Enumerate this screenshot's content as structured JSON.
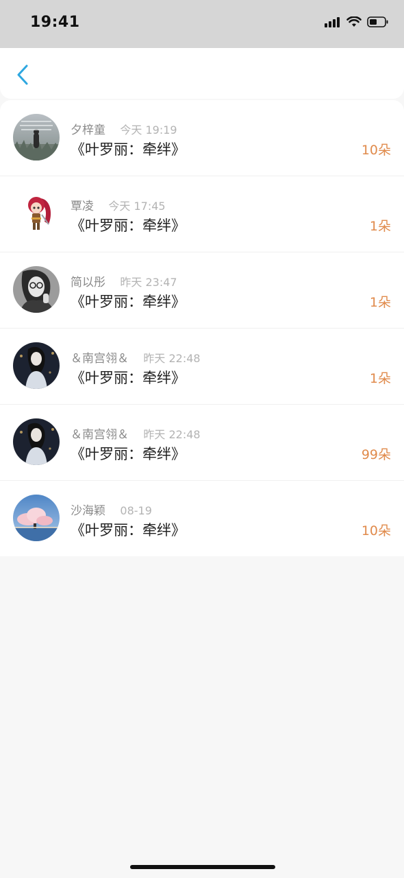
{
  "status_bar": {
    "time": "19:41"
  },
  "nav": {
    "back_icon": "chevron-left-icon",
    "accent_color": "#2ea7e0"
  },
  "list": [
    {
      "name": "夕梓童",
      "time": "今天 19:19",
      "title": "《叶罗丽：牵绊》",
      "count": "10朵"
    },
    {
      "name": "覃凌",
      "time": "今天 17:45",
      "title": "《叶罗丽：牵绊》",
      "count": "1朵"
    },
    {
      "name": "简以彤",
      "time": "昨天 23:47",
      "title": "《叶罗丽：牵绊》",
      "count": "1朵"
    },
    {
      "name": "＆南宫翎＆",
      "time": "昨天 22:48",
      "title": "《叶罗丽：牵绊》",
      "count": "1朵"
    },
    {
      "name": "＆南宫翎＆",
      "time": "昨天 22:48",
      "title": "《叶罗丽：牵绊》",
      "count": "99朵"
    },
    {
      "name": "沙海颖",
      "time": "08-19",
      "title": "《叶罗丽：牵绊》",
      "count": "10朵"
    }
  ],
  "colors": {
    "count": "#e08a4b",
    "background": "#f7f7f7"
  }
}
